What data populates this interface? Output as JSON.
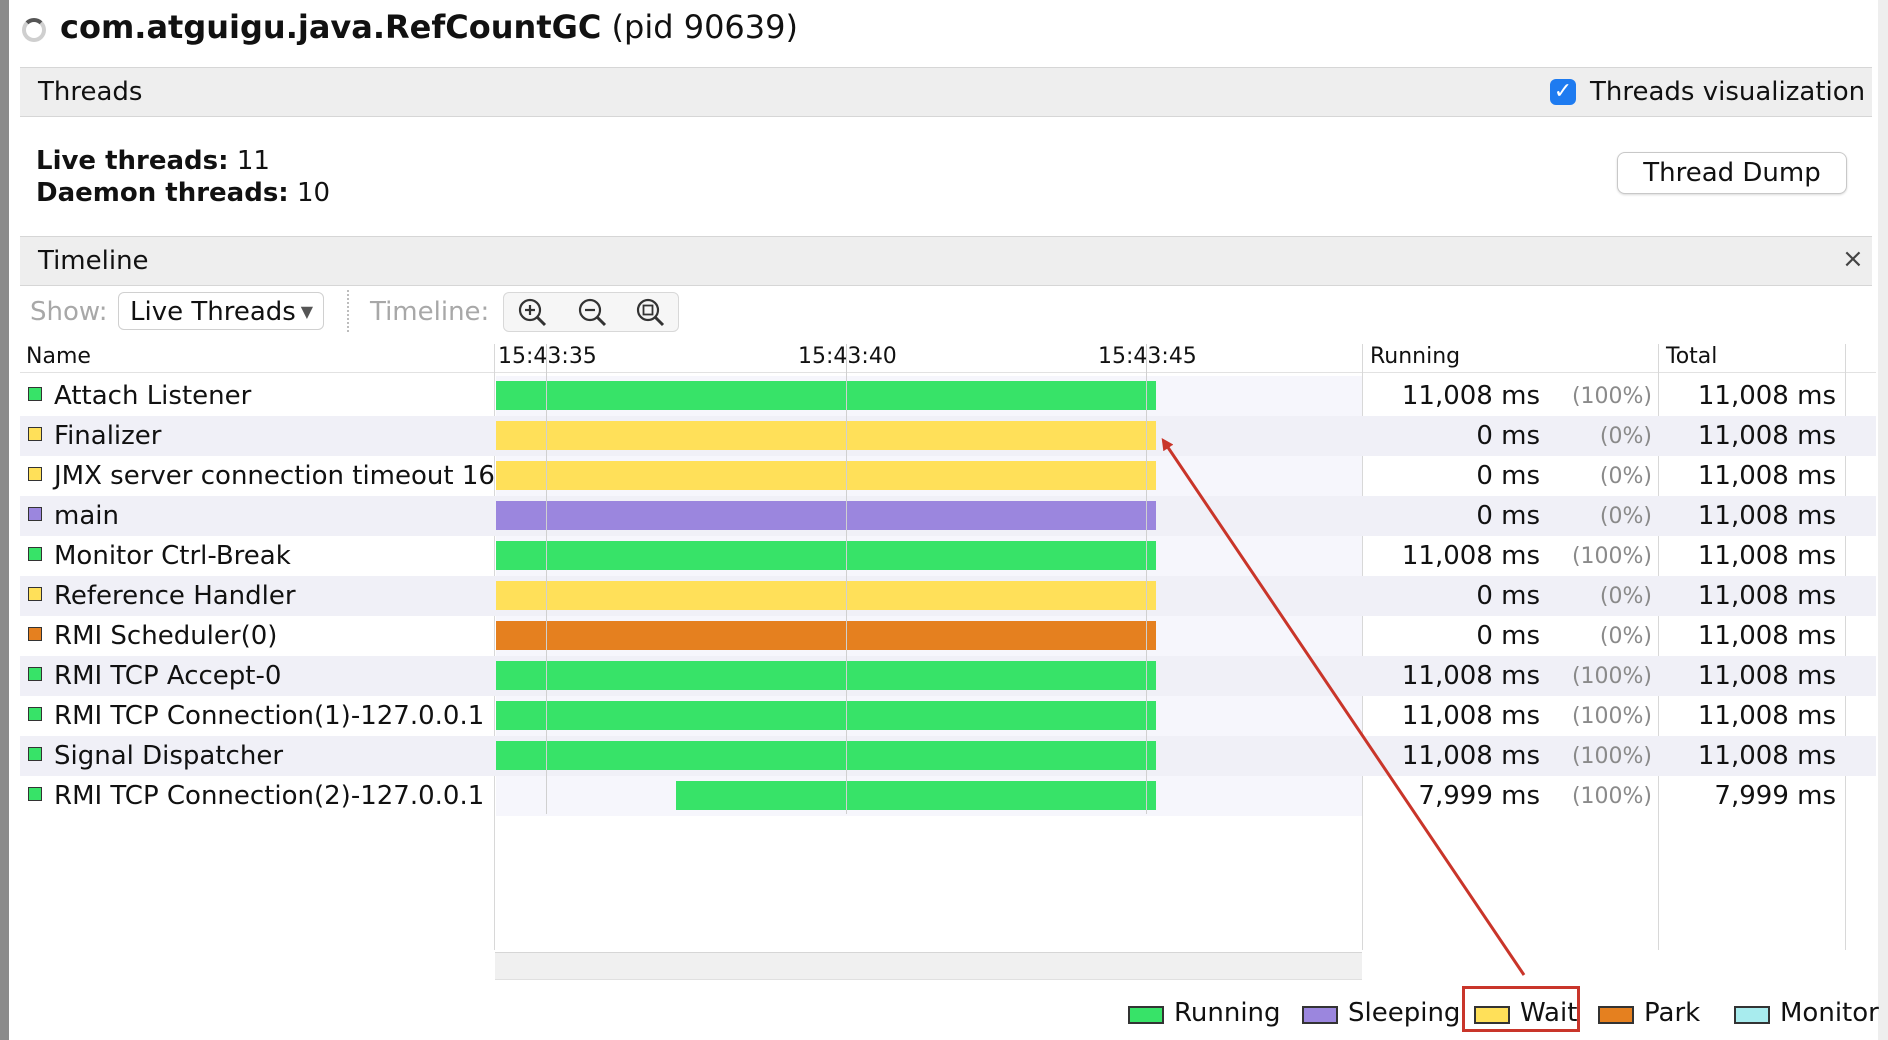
{
  "window": {
    "app_name": "com.atguigu.java.RefCountGC",
    "pid_text": "(pid 90639)"
  },
  "threads_panel": {
    "title": "Threads",
    "visualization_label": "Threads visualization",
    "visualization_checked": true,
    "live_label": "Live threads:",
    "live_value": "11",
    "daemon_label": "Daemon threads:",
    "daemon_value": "10",
    "thread_dump_button": "Thread Dump"
  },
  "timeline_panel": {
    "title": "Timeline",
    "close_symbol": "×",
    "show_label": "Show:",
    "show_value": "Live Threads",
    "timeline_label": "Timeline:",
    "zoom_buttons": [
      "zoom-in",
      "zoom-out",
      "zoom-fit"
    ]
  },
  "columns": {
    "name": "Name",
    "ticks": [
      "15:43:35",
      "15:43:40",
      "15:43:45"
    ],
    "running": "Running",
    "total": "Total"
  },
  "colors": {
    "running": "#37e368",
    "sleeping": "#9b86de",
    "wait": "#ffe059",
    "park": "#e5801f",
    "monitor": "#a8ecee"
  },
  "threads": [
    {
      "name": "Attach Listener",
      "state": "running",
      "start_fraction": 0.0,
      "running": "11,008 ms",
      "pct": "(100%)",
      "total": "11,008 ms"
    },
    {
      "name": "Finalizer",
      "state": "wait",
      "start_fraction": 0.0,
      "running": "0 ms",
      "pct": "(0%)",
      "total": "11,008 ms"
    },
    {
      "name": "JMX server connection timeout 16",
      "state": "wait",
      "start_fraction": 0.0,
      "running": "0 ms",
      "pct": "(0%)",
      "total": "11,008 ms"
    },
    {
      "name": "main",
      "state": "sleeping",
      "start_fraction": 0.0,
      "running": "0 ms",
      "pct": "(0%)",
      "total": "11,008 ms"
    },
    {
      "name": "Monitor Ctrl-Break",
      "state": "running",
      "start_fraction": 0.0,
      "running": "11,008 ms",
      "pct": "(100%)",
      "total": "11,008 ms"
    },
    {
      "name": "Reference Handler",
      "state": "wait",
      "start_fraction": 0.0,
      "running": "0 ms",
      "pct": "(0%)",
      "total": "11,008 ms"
    },
    {
      "name": "RMI Scheduler(0)",
      "state": "park",
      "start_fraction": 0.0,
      "running": "0 ms",
      "pct": "(0%)",
      "total": "11,008 ms"
    },
    {
      "name": "RMI TCP Accept-0",
      "state": "running",
      "start_fraction": 0.0,
      "running": "11,008 ms",
      "pct": "(100%)",
      "total": "11,008 ms"
    },
    {
      "name": "RMI TCP Connection(1)-127.0.0.1",
      "state": "running",
      "start_fraction": 0.0,
      "running": "11,008 ms",
      "pct": "(100%)",
      "total": "11,008 ms"
    },
    {
      "name": "Signal Dispatcher",
      "state": "running",
      "start_fraction": 0.0,
      "running": "11,008 ms",
      "pct": "(100%)",
      "total": "11,008 ms"
    },
    {
      "name": "RMI TCP Connection(2)-127.0.0.1",
      "state": "running",
      "start_fraction": 0.273,
      "running": "7,999 ms",
      "pct": "(100%)",
      "total": "7,999 ms"
    }
  ],
  "legend": [
    {
      "label": "Running",
      "state": "running"
    },
    {
      "label": "Sleeping",
      "state": "sleeping"
    },
    {
      "label": "Wait",
      "state": "wait"
    },
    {
      "label": "Park",
      "state": "park"
    },
    {
      "label": "Monitor",
      "state": "monitor"
    }
  ],
  "annotation": {
    "highlight": "Wait",
    "color": "#c9352a"
  }
}
